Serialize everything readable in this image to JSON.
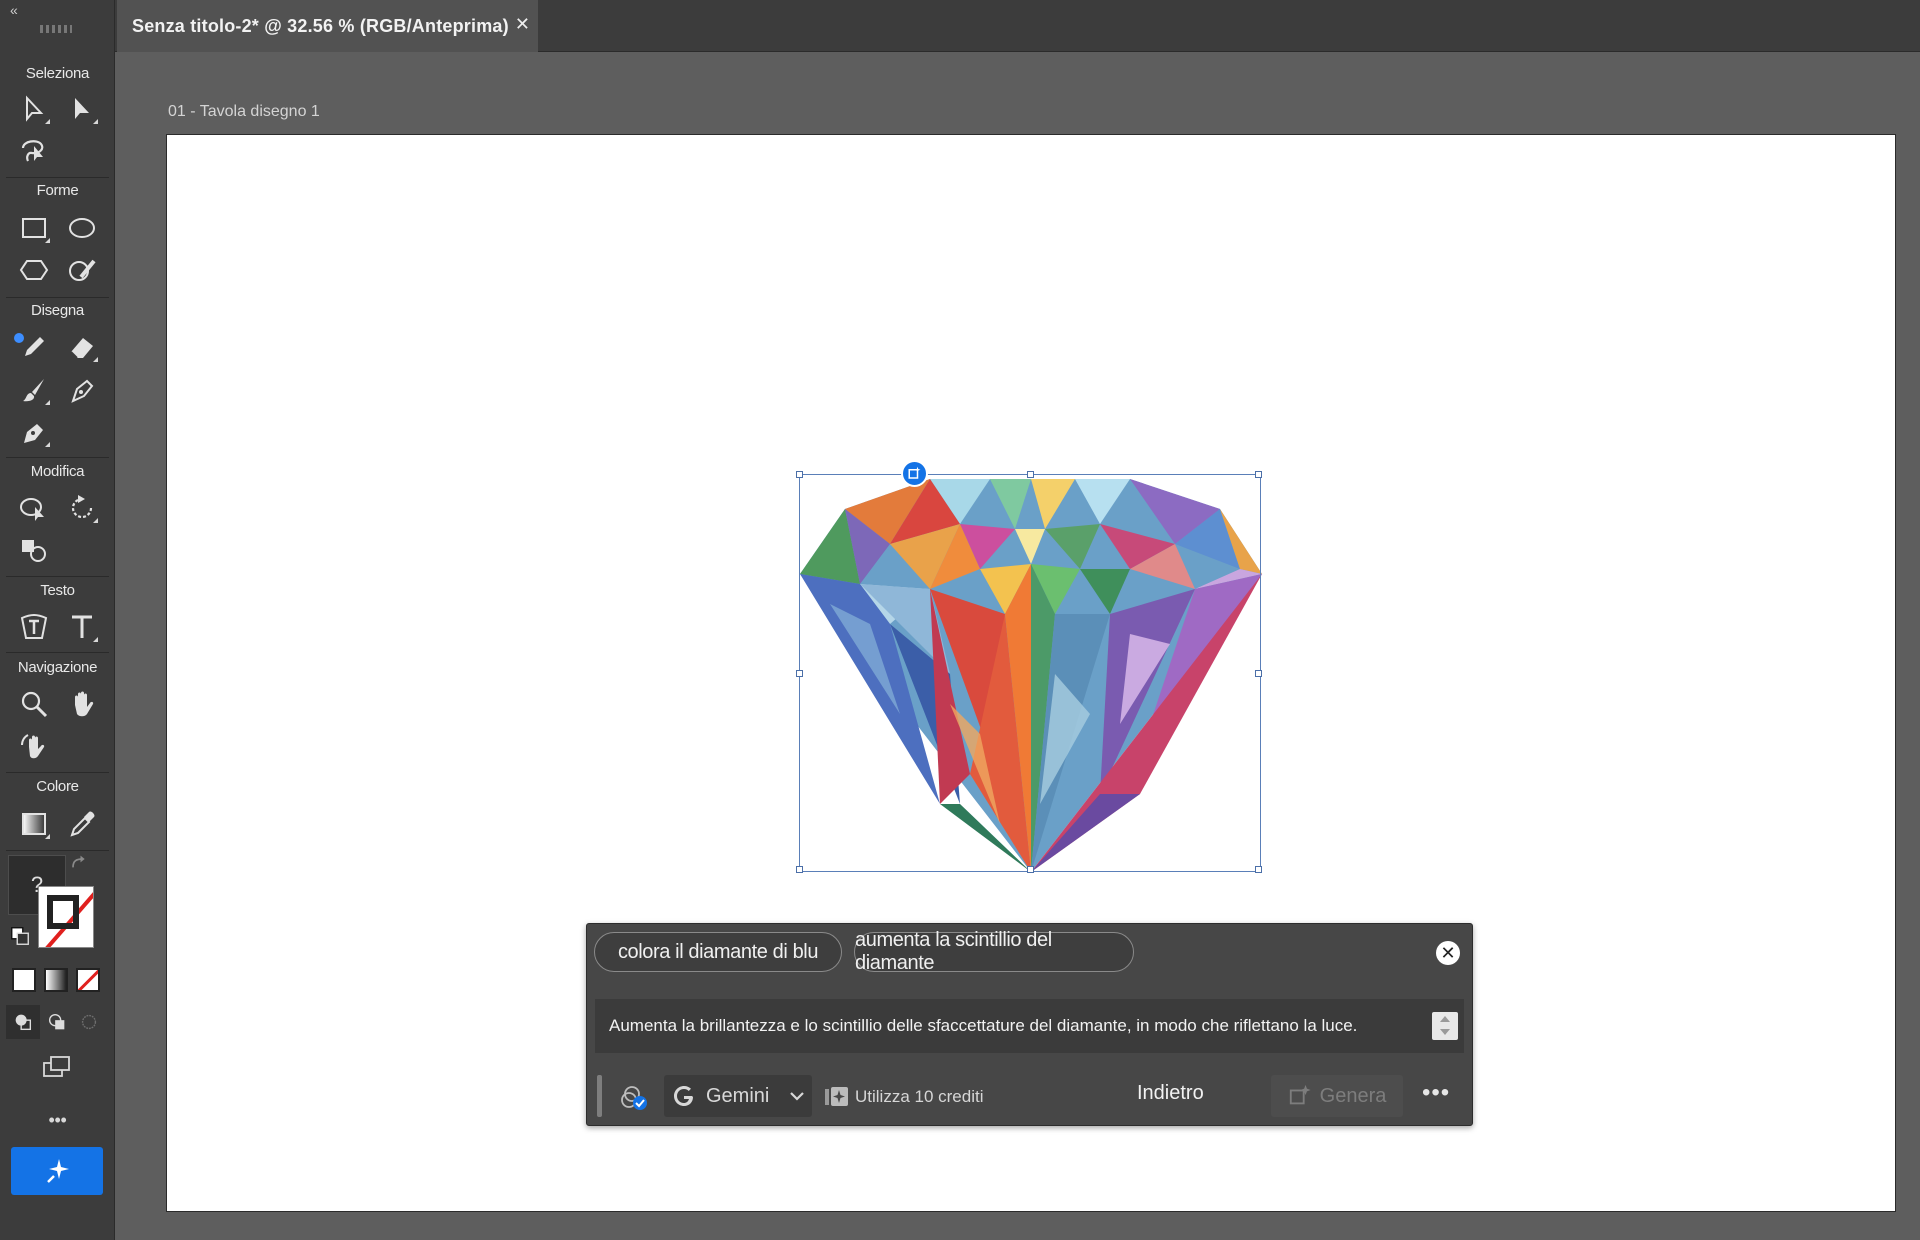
{
  "toolbar": {
    "collapse_glyph": "«",
    "sections": {
      "select": "Seleziona",
      "shapes": "Forme",
      "draw": "Disegna",
      "modify": "Modifica",
      "text": "Testo",
      "navigation": "Navigazione",
      "color": "Colore"
    },
    "unknown_fill_glyph": "?",
    "more_glyph": "•••",
    "accent_color": "#1473e6"
  },
  "document_tab": {
    "title": "Senza titolo-2* @ 32.56 % (RGB/Anteprima)",
    "close_glyph": "✕"
  },
  "artboard": {
    "label": "01 - Tavola disegno 1"
  },
  "prompt_panel": {
    "suggestions": [
      "colora il diamante di blu",
      "aumenta la scintillio del diamante"
    ],
    "close_glyph": "✕",
    "prompt_text": "Aumenta la brillantezza e lo scintillio delle sfaccettature del diamante, in modo che riflettano la luce.",
    "model_label": "Gemini",
    "credits_label": "Utilizza 10 crediti",
    "back_label": "Indietro",
    "generate_label": "Genera",
    "more_glyph": "•••"
  }
}
